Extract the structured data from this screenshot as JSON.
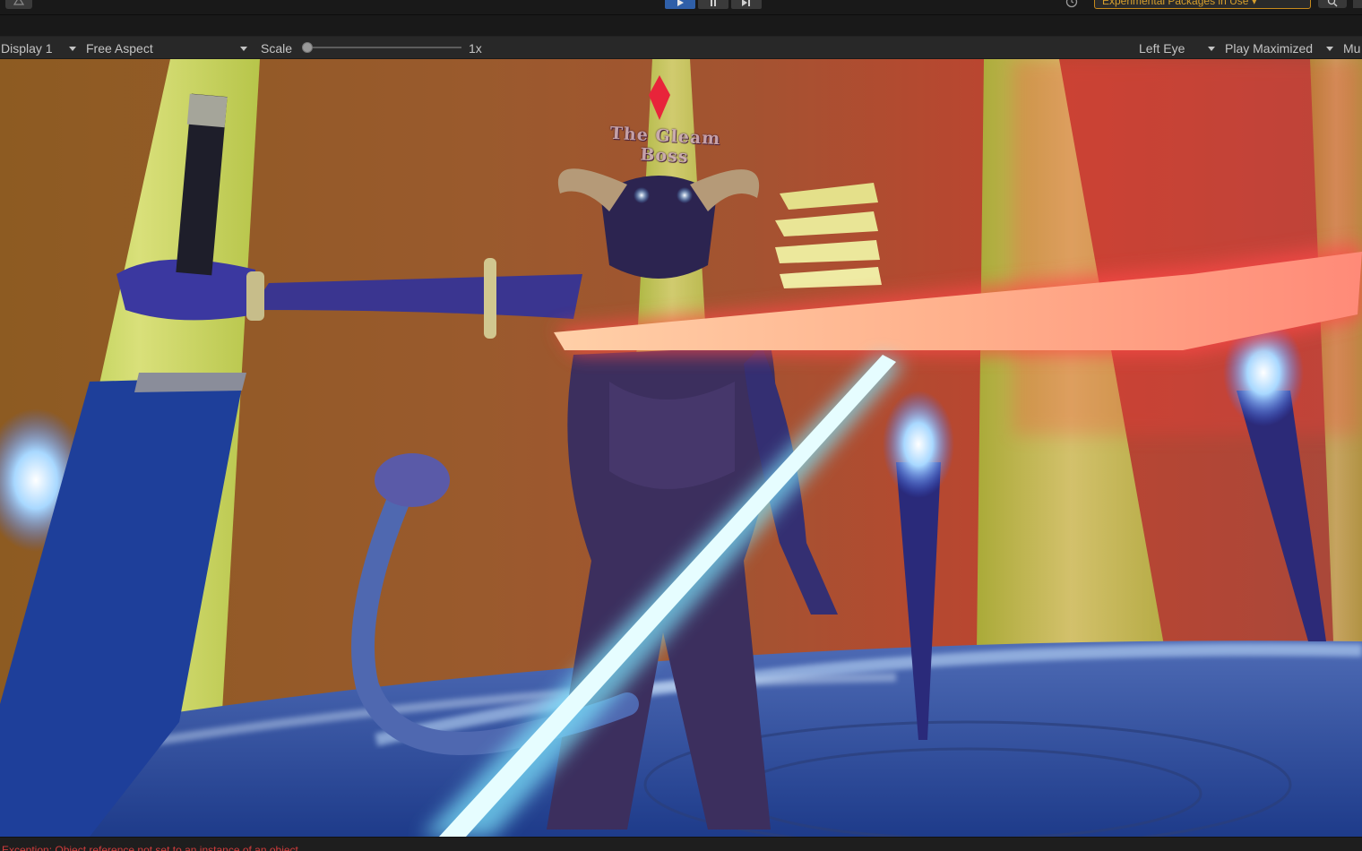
{
  "toolbar": {
    "experimental_packages_label": "Experimental Packages in Use",
    "play_state": "playing"
  },
  "game_view": {
    "display_label": "Display 1",
    "aspect_label": "Free Aspect",
    "scale_label": "Scale",
    "scale_value": "1x",
    "scale_fraction": 0.0,
    "eye_label": "Left Eye",
    "play_mode_label": "Play Maximized",
    "mute_label": "Mu"
  },
  "scene": {
    "enemy_name_tag": "The Gleam Boss",
    "target_marker_color": "#e8243a",
    "accent_colors": {
      "red_blade": "#ff7a6e",
      "cyan_blade": "#8ff5ff",
      "blue_flame": "#7ab8ff",
      "pillar": "#c9d45a"
    }
  },
  "console": {
    "status_message": "Exception: Object reference not set to an instance of an object"
  },
  "colors": {
    "play_active": "#2f5fa8",
    "warning_orange": "#d79f2c",
    "error_red": "#d23c3c"
  }
}
